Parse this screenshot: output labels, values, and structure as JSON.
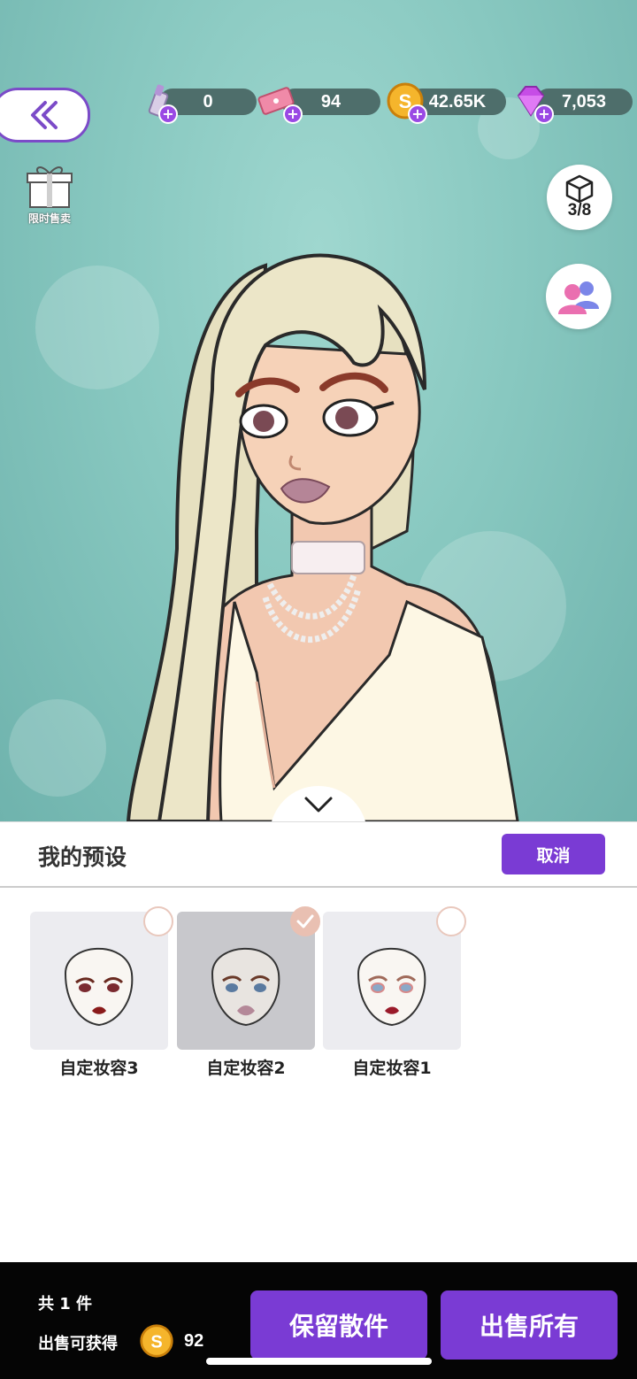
{
  "topbar": {
    "currencies": [
      {
        "icon": "lipstick-icon",
        "value": "0"
      },
      {
        "icon": "ticket-icon",
        "value": "94"
      },
      {
        "icon": "gold-coin-icon",
        "value": "42.65K"
      },
      {
        "icon": "diamond-icon",
        "value": "7,053"
      }
    ]
  },
  "gift": {
    "label": "限时售卖"
  },
  "wardrobe": {
    "count": "3/8"
  },
  "panel": {
    "title": "我的预设",
    "cancel_label": "取消",
    "presets": [
      {
        "label": "自定妆容3",
        "selected": false
      },
      {
        "label": "自定妆容2",
        "selected": true
      },
      {
        "label": "自定妆容1",
        "selected": false
      }
    ]
  },
  "footer": {
    "count_text": "共 1 件",
    "earn_label": "出售可获得",
    "earn_amount": "92",
    "keep_label": "保留散件",
    "sell_label": "出售所有"
  },
  "colors": {
    "accent": "#7a3bd4",
    "background": "#88c8c0"
  }
}
